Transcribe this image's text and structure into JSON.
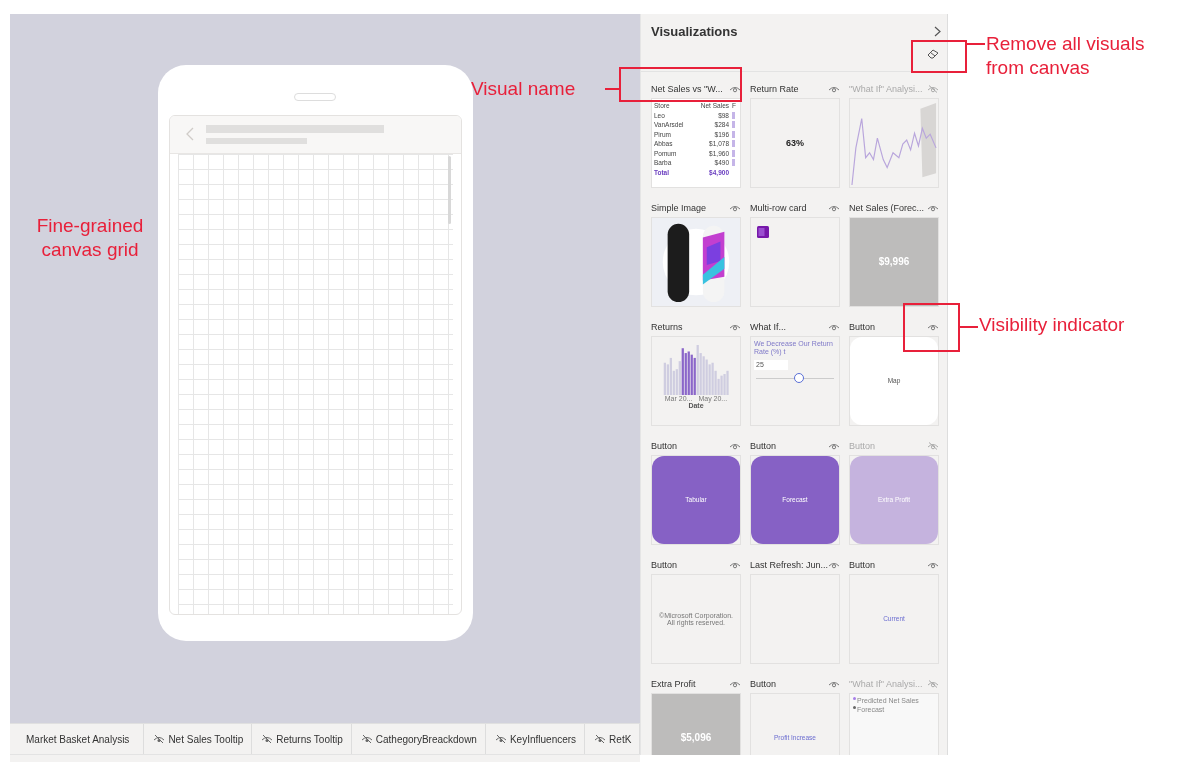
{
  "panel": {
    "title": "Visualizations"
  },
  "visuals": [
    {
      "name": "Net Sales vs \"W...",
      "visible": true,
      "kind": "table",
      "columns": [
        "Store",
        "Net Sales",
        "F"
      ],
      "rows": [
        [
          "Leo",
          "$98"
        ],
        [
          "VanArsdel",
          "$284"
        ],
        [
          "Pirum",
          "$196"
        ],
        [
          "Abbas",
          "$1,078"
        ],
        [
          "Pomum",
          "$1,960"
        ],
        [
          "Barba",
          "$490"
        ]
      ],
      "total": [
        "Total",
        "$4,900"
      ]
    },
    {
      "name": "Return Rate",
      "visible": true,
      "kind": "card",
      "value": "63%"
    },
    {
      "name": "\"What If\" Analysi...",
      "visible": false,
      "kind": "line"
    },
    {
      "name": "Simple Image",
      "visible": true
    },
    {
      "name": "Multi-row card",
      "visible": true,
      "kind": "multirow"
    },
    {
      "name": "Net Sales (Forec...",
      "visible": true,
      "kind": "light_card",
      "value": "$9,996"
    },
    {
      "name": "Returns",
      "visible": true,
      "kind": "columns",
      "ticks": [
        "Mar 20...",
        "May 20..."
      ],
      "axis": "Date"
    },
    {
      "name": "What If...",
      "visible": true,
      "kind": "slicer",
      "label": "We Decrease Our Return Rate (%) t",
      "value": "25",
      "level": 0.55
    },
    {
      "name": "Button",
      "visible": true,
      "kind": "button",
      "label": "Map",
      "color": "#ffffff"
    },
    {
      "name": "Button",
      "visible": true,
      "kind": "button",
      "label": "Tabular",
      "color": "#8661c5"
    },
    {
      "name": "Button",
      "visible": true,
      "kind": "button",
      "label": "Forecast",
      "color": "#8661c5"
    },
    {
      "name": "Button",
      "visible": false,
      "kind": "button",
      "label": "Extra Profit",
      "color": "#c5b3de"
    },
    {
      "name": "Button",
      "visible": true,
      "kind": "text",
      "label": "©Microsoft Corporation. All rights reserved."
    },
    {
      "name": "Last Refresh: Jun...",
      "visible": true,
      "kind": "blank"
    },
    {
      "name": "Button",
      "visible": true,
      "kind": "link",
      "label": "Current"
    },
    {
      "name": "Extra Profit",
      "visible": true,
      "kind": "light_card",
      "value": "$5,096"
    },
    {
      "name": "Button",
      "visible": true,
      "kind": "link",
      "label": "Profit Increase"
    },
    {
      "name": "\"What If\" Analysi...",
      "visible": false,
      "kind": "legend",
      "legend": [
        {
          "label": "Predicted Net Sales",
          "color": "#a77fe8"
        },
        {
          "label": "Forecast",
          "color": "#666666"
        }
      ]
    }
  ],
  "page_tabs": [
    {
      "label": "Market Basket Analysis",
      "hidden": false
    },
    {
      "label": "Net Sales Tooltip",
      "hidden": true
    },
    {
      "label": "Returns Tooltip",
      "hidden": true
    },
    {
      "label": "CathegoryBreackdown",
      "hidden": true
    },
    {
      "label": "KeyInfluencers",
      "hidden": true
    },
    {
      "label": "RetK",
      "hidden": true
    }
  ],
  "callouts": {
    "remove_all": "Remove all visuals from canvas",
    "visual_name": "Visual name",
    "visibility": "Visibility indicator",
    "grid": "Fine-grained canvas grid"
  }
}
